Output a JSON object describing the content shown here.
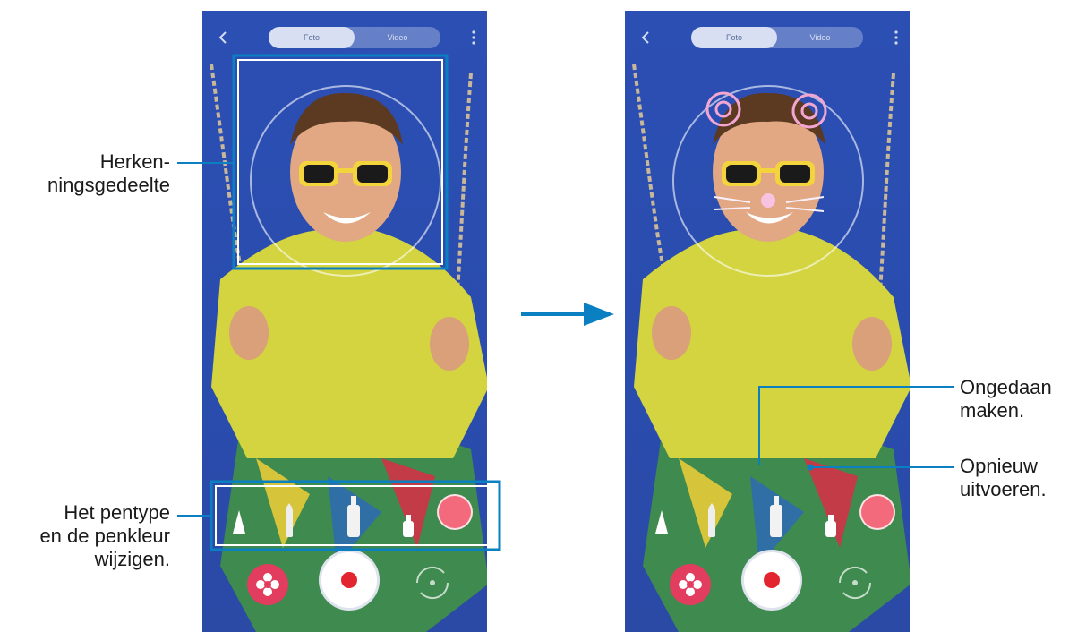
{
  "screens": [
    {
      "id": "left",
      "mode_tabs": [
        "Foto",
        "Video"
      ],
      "state": "recognition"
    },
    {
      "id": "right",
      "mode_tabs": [
        "Foto",
        "Video"
      ],
      "state": "drawn-effect"
    }
  ],
  "annotations": {
    "recognition_area": [
      "Herken-",
      "ningsgedeelte"
    ],
    "pen_settings": [
      "Het pentype",
      "en de penkleur",
      "wijzigen."
    ],
    "undo": [
      "Ongedaan",
      "maken."
    ],
    "redo": [
      "Opnieuw",
      "uitvoeren."
    ]
  },
  "icons": {
    "back": "chevron-left-icon",
    "more": "more-vertical-icon",
    "effects": "flower-icon",
    "shutter": "record-icon",
    "switch_camera": "switch-camera-icon",
    "next_step": "arrow-right-icon"
  },
  "colors": {
    "background_blue": "#2b4db0",
    "callout": "#0a7fc2",
    "effects_button": "#e23c5e",
    "pen_color": "#f26a7b",
    "shutter_dot": "#e3252f"
  }
}
